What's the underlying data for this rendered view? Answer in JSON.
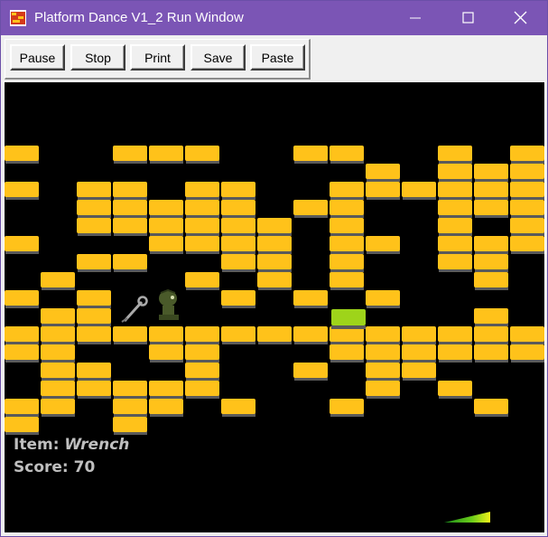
{
  "window": {
    "title": "Platform Dance V1_2 Run Window"
  },
  "toolbar": {
    "buttons": [
      "Pause",
      "Stop",
      "Print",
      "Save",
      "Paste"
    ]
  },
  "hud": {
    "item_label": "Item:",
    "item_value": "Wrench",
    "score_label": "Score:",
    "score_value": "70"
  },
  "game": {
    "brick_color": "#ffc21a",
    "brick_shadow": "#5a5a5a",
    "goal_color": "#9ed41a",
    "player_color": "#4a5a2a",
    "rows": [
      "#..###..##..#.#####",
      "..........#.#######",
      "#.##.##..######.###",
      "..#####.##..#######",
      "..######.#..#.#.###",
      "#...####.##.###..##",
      "..##..##.#..##..###",
      ".#...#.#.#...#..#..",
      "#.#...#.#.#....#.#.",
      ".##..........#..###",
      "#################.#",
      "##..##...######...#",
      ".##..#..#.##.....#.",
      ".#####....#.#..#.##",
      "##.##.#..#...#..###",
      "#..#...........#.##"
    ]
  }
}
